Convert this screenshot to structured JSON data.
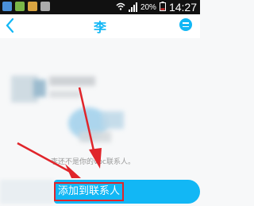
{
  "status_bar": {
    "battery": "20%",
    "time": "14:27"
  },
  "header": {
    "title": "李"
  },
  "profile": {
    "hint": "李还不是你的vpc联系人。"
  },
  "actions": {
    "add_contact": "添加到联系人"
  },
  "colors": {
    "accent": "#12b7f5",
    "highlight": "#e0252b"
  }
}
